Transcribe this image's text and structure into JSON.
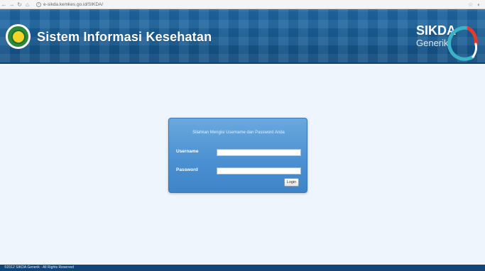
{
  "browser": {
    "url": "e-sikda.kemkes.go.id/SIKDA/",
    "back_icon": "back-arrow-icon",
    "forward_icon": "forward-arrow-icon",
    "reload_icon": "reload-icon",
    "home_icon": "home-icon"
  },
  "header": {
    "title": "Sistem Informasi Kesehatan",
    "brand_main": "SIKDA",
    "brand_sub": "Generik",
    "colors": {
      "header_blue": "#195f98",
      "ring_teal": "#3bb3c7",
      "ring_red": "#e23a2e"
    }
  },
  "login": {
    "prompt": "Silahkan Mengisi Username dan Password Anda",
    "username_label": "Username",
    "username_value": "",
    "password_label": "Password",
    "password_value": "",
    "button_label": "Login"
  },
  "footer": {
    "text": "©2012 SIKDA Generik - All Rights Reserved"
  }
}
